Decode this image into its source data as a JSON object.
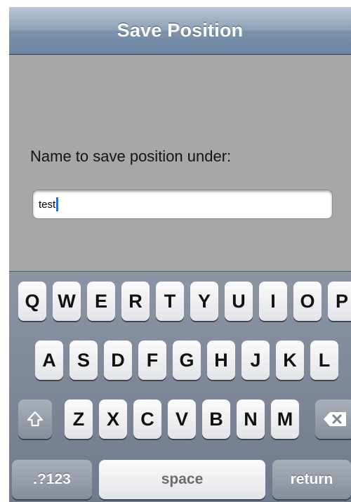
{
  "navbar": {
    "title": "Save Position"
  },
  "form": {
    "label": "Name to save position under:",
    "input_value": "test"
  },
  "keyboard": {
    "row1": [
      "Q",
      "W",
      "E",
      "R",
      "T",
      "Y",
      "U",
      "I",
      "O",
      "P"
    ],
    "row2": [
      "A",
      "S",
      "D",
      "F",
      "G",
      "H",
      "J",
      "K",
      "L"
    ],
    "row3": [
      "Z",
      "X",
      "C",
      "V",
      "B",
      "N",
      "M"
    ],
    "numbers_label": ".?123",
    "space_label": "space",
    "return_label": "return",
    "shift_icon": "shift-arrow-icon",
    "backspace_icon": "backspace-icon"
  },
  "colors": {
    "navbar": "#7b91ab",
    "background": "#a7a7a7",
    "caret": "#2b6fd6"
  }
}
